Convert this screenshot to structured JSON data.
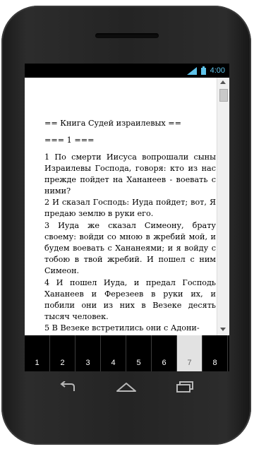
{
  "status_bar": {
    "time": "4:00",
    "icons": [
      "signal-icon",
      "battery-icon"
    ],
    "clock_color": "#5fc3ea"
  },
  "reader": {
    "book_title": "== Книга Судей израилевых ==",
    "chapter_heading": "=== 1 ===",
    "verses": [
      "1 По смерти Иисуса вопрошали сыны Израилевы Господа, говоря: кто из нас прежде пойдет на Хананеев - воевать с ними?",
      "2 И сказал Господь: Иуда пойдет; вот, Я предаю землю в руки его.",
      "3 Иуда же сказал Симеону, брату своему: войди со мною в жребий мой, и будем воевать с Хананеями; и я войду с тобою в твой жребий. И пошел с ним Симеон.",
      "4 И пошел Иуда, и предал Господь Хананеев и Ферезеев в руки их, и побили они из них в Везеке десять тысяч человек.",
      "5 В Везеке встретились они с Адони-"
    ]
  },
  "tabs": [
    {
      "label": "1",
      "active": false
    },
    {
      "label": "2",
      "active": false
    },
    {
      "label": "3",
      "active": false
    },
    {
      "label": "4",
      "active": false
    },
    {
      "label": "5",
      "active": false
    },
    {
      "label": "6",
      "active": false
    },
    {
      "label": "7",
      "active": true
    },
    {
      "label": "8",
      "active": false
    }
  ],
  "nav": {
    "icons": [
      "back-icon",
      "home-icon",
      "recent-apps-icon"
    ]
  }
}
